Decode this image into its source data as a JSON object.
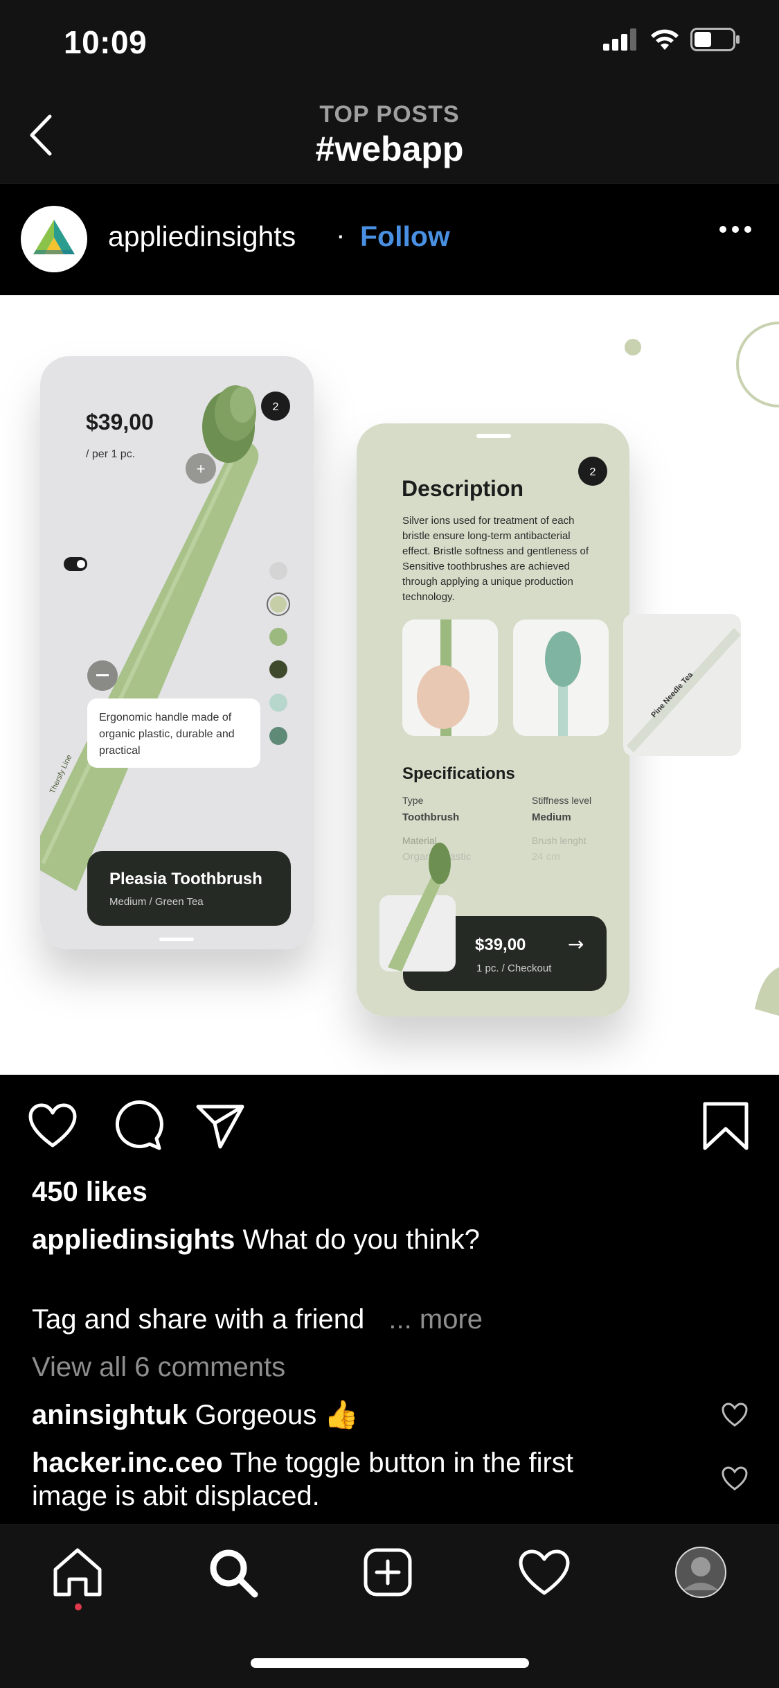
{
  "status_bar": {
    "time": "10:09"
  },
  "header": {
    "subtitle": "TOP POSTS",
    "title": "#webapp"
  },
  "post": {
    "username": "appliedinsights",
    "separator": "·",
    "follow_label": "Follow",
    "image": {
      "card1": {
        "price": "$39,00",
        "per": "/ per 1 pc.",
        "badge": "2",
        "tooltip": "Ergonomic handle made of organic plastic, durable and practical",
        "product_name": "Pleasia Toothbrush",
        "product_variant": "Medium / Green Tea",
        "handle_text": "Thersfy Line",
        "swatch_colors": [
          "#d4d4d4",
          "#c5cea6",
          "#9cb97f",
          "#3f4a2c",
          "#b7d6cc",
          "#5f8a78"
        ]
      },
      "card2": {
        "badge": "2",
        "description_title": "Description",
        "description_lines": [
          "Silver ions used for treatment of each",
          "bristle ensure long-term antibacterial",
          "effect. Bristle softness and gentleness of",
          "Sensitive toothbrushes are achieved",
          "through applying a unique production",
          "technology."
        ],
        "spec_title": "Specifications",
        "spec_type_label": "Type",
        "spec_type_value": "Toothbrush",
        "spec_stiff_label": "Stiffness level",
        "spec_stiff_value": "Medium",
        "spec_material_label": "Material",
        "spec_material_value": "Organic plastic",
        "spec_length_label": "Brush lenght",
        "spec_length_value": "24 cm",
        "checkout_price": "$39,00",
        "checkout_sub": "1 pc. / Checkout",
        "checkout_arrow": "→",
        "side_text": "Pine Needle Tea"
      }
    },
    "likes": "450 likes",
    "caption_user": "appliedinsights",
    "caption_text": "What do you think?",
    "caption_line2": "Tag and share with a friend",
    "more_label": "... more",
    "view_comments": "View all 6 comments",
    "comments": [
      {
        "user": "aninsightuk",
        "text": "Gorgeous 👍"
      },
      {
        "user": "hacker.inc.ceo",
        "text": "The toggle button in the first image is abit displaced."
      }
    ]
  },
  "colors": {
    "accent": "#4a90e2",
    "notification": "#e0384b",
    "sage": "#d6dcc8",
    "dark": "#262a24"
  }
}
